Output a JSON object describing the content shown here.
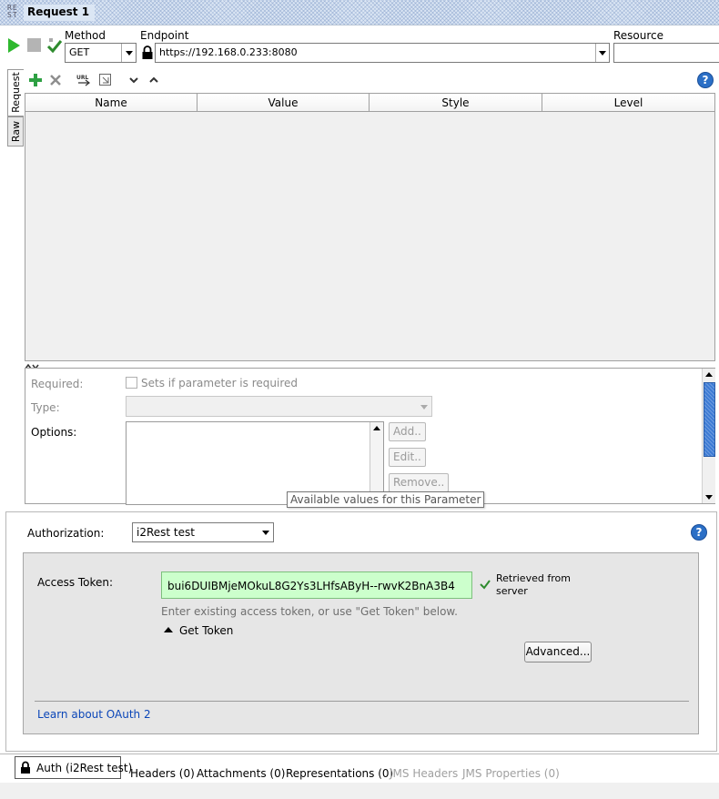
{
  "window": {
    "logo": "RE ST",
    "title": "Request 1"
  },
  "toolbar": {
    "method_label": "Method",
    "method_value": "GET",
    "endpoint_label": "Endpoint",
    "endpoint_value": "https://192.168.0.233:8080",
    "resource_label": "Resource",
    "icons": [
      "play-icon",
      "stop-icon",
      "check-icon"
    ]
  },
  "side_tabs": {
    "request": "Request",
    "raw": "Raw"
  },
  "param_toolbar": {
    "icons": [
      "add-icon",
      "delete-icon",
      "url-icon",
      "move-icon",
      "chevron-down-icon",
      "chevron-up-icon",
      "help-icon"
    ]
  },
  "param_table": {
    "columns": [
      "Name",
      "Value",
      "Style",
      "Level"
    ],
    "rows": []
  },
  "details": {
    "required_label": "Required:",
    "required_checkbox_label": "Sets if parameter is required",
    "type_label": "Type:",
    "options_label": "Options:",
    "add_button": "Add..",
    "edit_button": "Edit..",
    "remove_button": "Remove..",
    "tooltip": "Available values for this Parameter"
  },
  "auth": {
    "authorization_label": "Authorization:",
    "authorization_value": "i2Rest test",
    "access_token_label": "Access Token:",
    "access_token_value": "bui6DUIBMjeMOkuL8G2Ys3LHfsAByH--rwvK2BnA3B4",
    "token_status": "Retrieved from server",
    "token_hint": "Enter existing access token, or use \"Get Token\" below.",
    "get_token_label": "Get Token",
    "advanced_button": "Advanced...",
    "learn_link": "Learn about OAuth 2",
    "colors": {
      "token_bg": "#ccffcc",
      "link": "#0b46b8"
    }
  },
  "bottom_tabs": [
    {
      "label": "Auth (i2Rest test)",
      "active": true
    },
    {
      "label": "Headers (0)",
      "active": false
    },
    {
      "label": "Attachments (0)",
      "active": false
    },
    {
      "label": "Representations (0)",
      "active": false
    },
    {
      "label": "JMS Headers",
      "active": false,
      "disabled": true
    },
    {
      "label": "JMS Properties (0)",
      "active": false,
      "disabled": true
    }
  ]
}
